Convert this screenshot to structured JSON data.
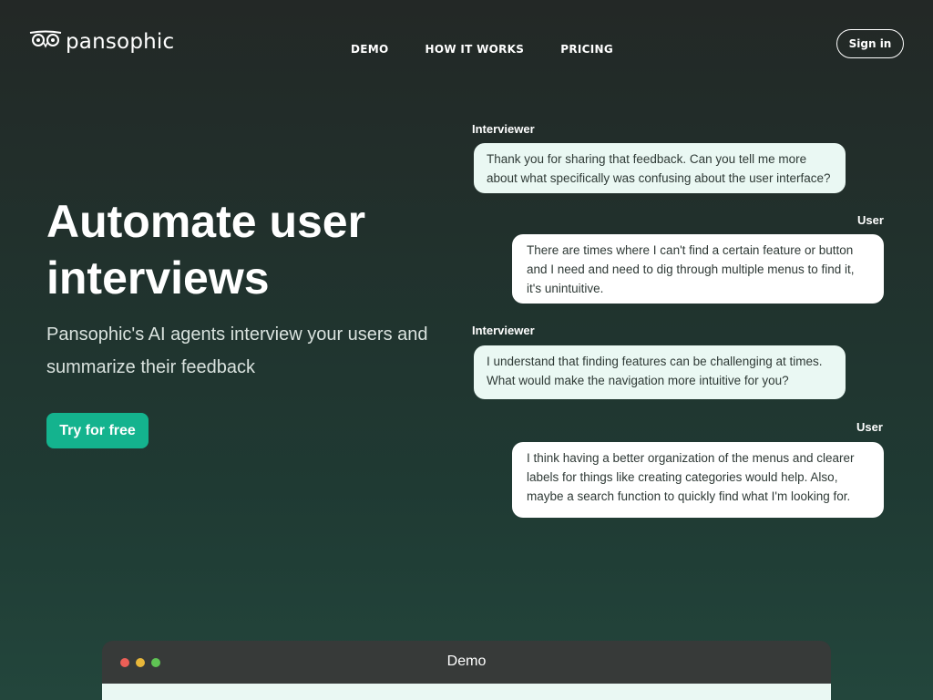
{
  "brand": {
    "name": "pansophic",
    "logo_icon": "owl-eyes-icon"
  },
  "nav": {
    "items": [
      "DEMO",
      "HOW IT WORKS",
      "PRICING"
    ]
  },
  "header": {
    "signin_label": "Sign in"
  },
  "hero": {
    "title": "Automate user interviews",
    "subtitle": "Pansophic's AI agents interview your users and summarize their feedback",
    "cta_label": "Try for free"
  },
  "chat": [
    {
      "speaker": "Interviewer",
      "text": "Thank you for sharing that feedback. Can you tell me more about what specifically was confusing about the user interface?"
    },
    {
      "speaker": "User",
      "text": "There are times where I can't find a certain feature or button and I need and need to dig through multiple menus to find it, it's unintuitive."
    },
    {
      "speaker": "Interviewer",
      "text": "I understand that finding features can be challenging at times. What would make the navigation more intuitive for you?"
    },
    {
      "speaker": "User",
      "text": "I think having a better organization of the menus and clearer labels for things like creating categories would help. Also, maybe a search function to quickly find what I'm looking for."
    }
  ],
  "demo": {
    "title": "Demo"
  },
  "colors": {
    "accent": "#14b38e",
    "interviewer_bubble": "#eaf8f3",
    "user_bubble": "#ffffff",
    "dot_red": "#ec5f57",
    "dot_yellow": "#e8b73a",
    "dot_green": "#5fc454"
  }
}
